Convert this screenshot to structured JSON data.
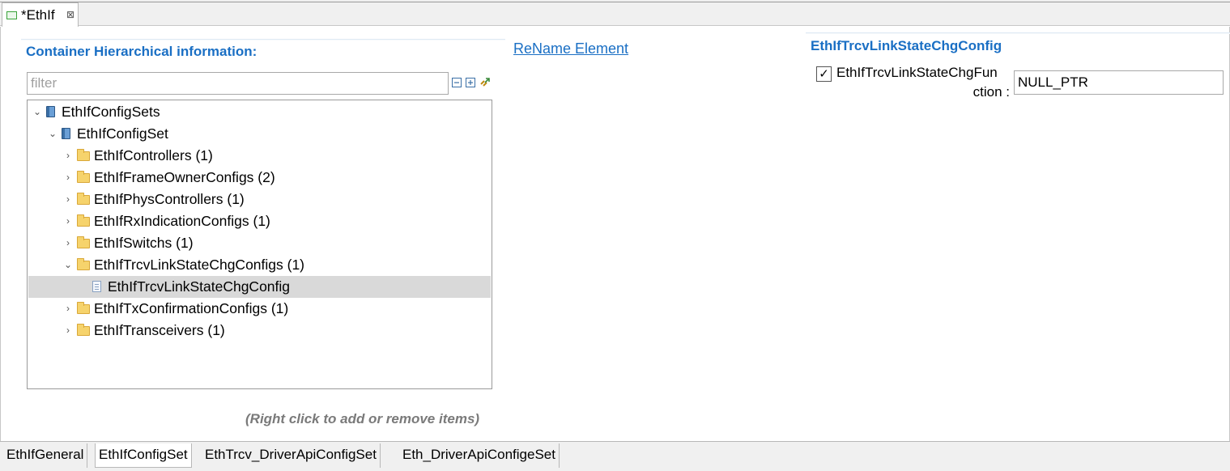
{
  "editor_tab": {
    "title": "*EthIf",
    "close": "⊠"
  },
  "left": {
    "section_title": "Container Hierarchical information:",
    "filter_placeholder": "filter",
    "tree": [
      {
        "label": "EthIfConfigSets",
        "level": 0,
        "icon": "book-icon",
        "arrow": "⌄",
        "selected": false
      },
      {
        "label": "EthIfConfigSet",
        "level": 1,
        "icon": "book-icon",
        "arrow": "⌄",
        "selected": false
      },
      {
        "label": "EthIfControllers (1)",
        "level": 2,
        "icon": "folder-icon",
        "arrow": "›",
        "selected": false
      },
      {
        "label": "EthIfFrameOwnerConfigs (2)",
        "level": 2,
        "icon": "folder-icon",
        "arrow": "›",
        "selected": false
      },
      {
        "label": "EthIfPhysControllers (1)",
        "level": 2,
        "icon": "folder-icon",
        "arrow": "›",
        "selected": false
      },
      {
        "label": "EthIfRxIndicationConfigs (1)",
        "level": 2,
        "icon": "folder-icon",
        "arrow": "›",
        "selected": false
      },
      {
        "label": "EthIfSwitchs (1)",
        "level": 2,
        "icon": "folder-icon",
        "arrow": "›",
        "selected": false
      },
      {
        "label": "EthIfTrcvLinkStateChgConfigs (1)",
        "level": 2,
        "icon": "folder-icon",
        "arrow": "⌄",
        "selected": false
      },
      {
        "label": "EthIfTrcvLinkStateChgConfig",
        "level": 3,
        "icon": "document-icon",
        "arrow": "",
        "selected": true
      },
      {
        "label": "EthIfTxConfirmationConfigs (1)",
        "level": 2,
        "icon": "folder-icon",
        "arrow": "›",
        "selected": false
      },
      {
        "label": "EthIfTransceivers (1)",
        "level": 2,
        "icon": "folder-icon",
        "arrow": "›",
        "selected": false
      }
    ],
    "hint": "(Right click to add or remove items)"
  },
  "rename_link": "ReName Element",
  "right": {
    "section_title": "EthIfTrcvLinkStateChgConfig",
    "param": {
      "label_line1": "EthIfTrcvLinkStateChgFun",
      "label_line2": "ction :",
      "checked": true,
      "value": "NULL_PTR"
    }
  },
  "bottom_tabs": [
    {
      "label": "EthIfGeneral",
      "active": false
    },
    {
      "label": "EthIfConfigSet",
      "active": true
    },
    {
      "label": "EthTrcv_DriverApiConfigSet",
      "active": false
    },
    {
      "label": "Eth_DriverApiConfigeSet",
      "active": false
    }
  ]
}
